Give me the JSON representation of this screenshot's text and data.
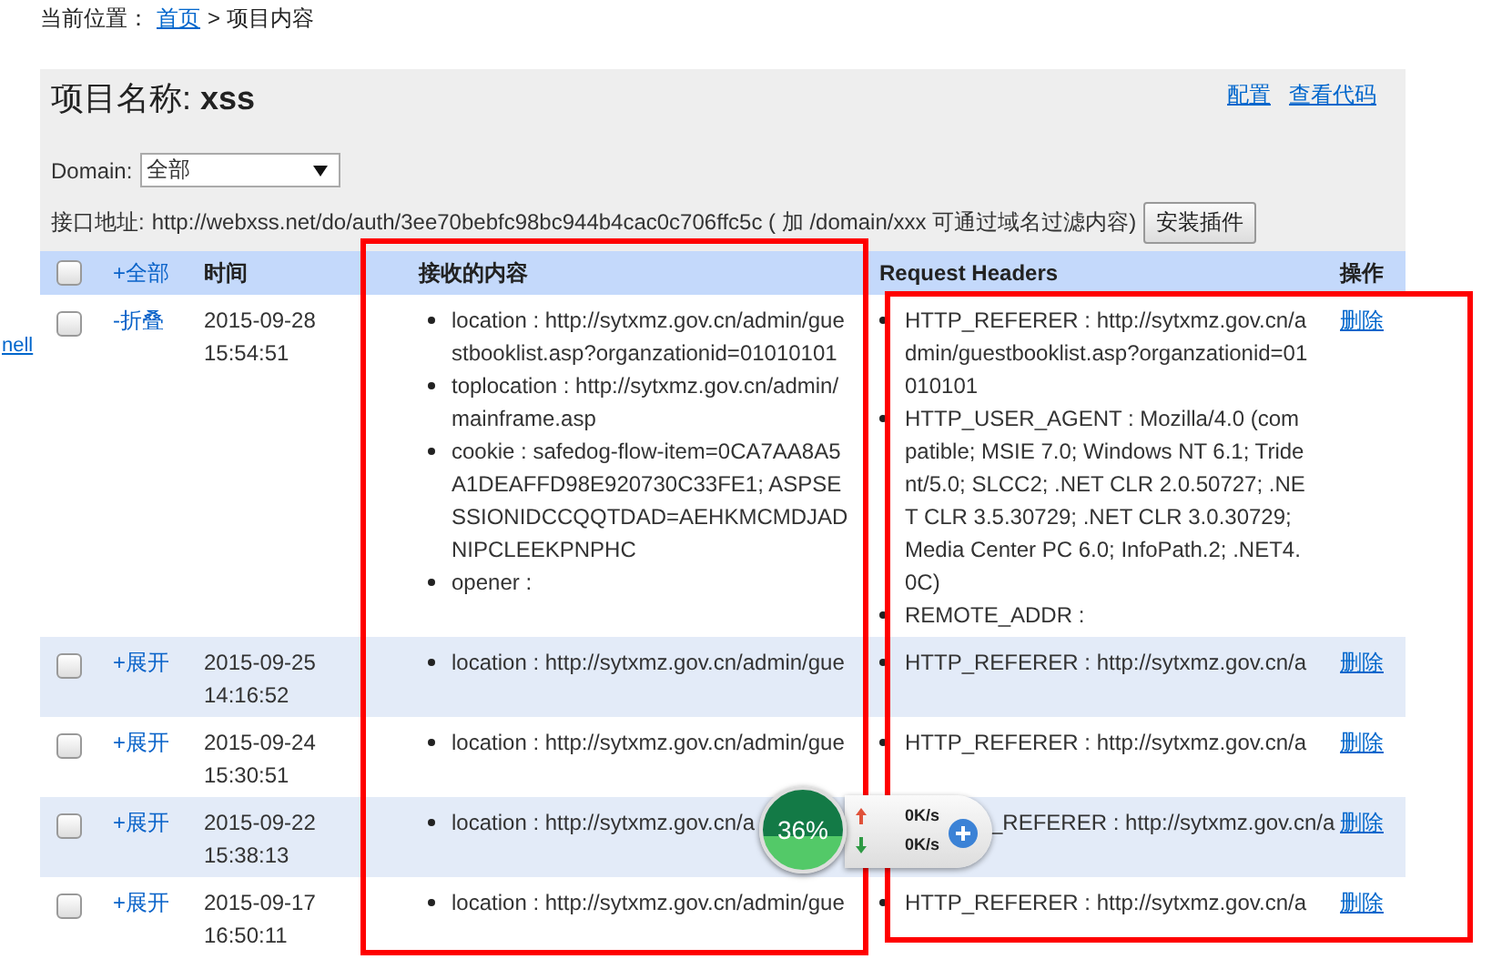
{
  "sidebar": {
    "link": "nell"
  },
  "breadcrumb": {
    "label": "当前位置：",
    "home_link": "首页",
    "current": "> 项目内容"
  },
  "project": {
    "title": "项目名称: **xss**",
    "links": [
      "配置",
      "查看代码"
    ],
    "domain_label": "Domain:",
    "domain_value": "全部",
    "address_label": "接口地址:",
    "address": "http://webxss.net/do/auth/3ee70bebfc98bc944b4cac0c706ffc5c ( 加 /domain/xxx 可通过域名过滤内容)",
    "install_button": "安装插件"
  },
  "table": {
    "header": {
      "select_all_checked": false,
      "toggle_all": "+全部",
      "time": "时间",
      "content": "接收的内容",
      "headers": "Request Headers",
      "action": "操作"
    },
    "rows": [
      {
        "checked": false,
        "partly_hidden": false,
        "toggle": "-折叠",
        "time": "2015-09-28 15:54:51",
        "content": [
          "location : http://sytxmz.gov.cn/admin/guestbooklist.asp?organzationid=01010101",
          "toplocation : http://sytxmz.gov.cn/admin/mainframe.asp",
          "cookie : safedog-flow-item=0CA7AA8A5A1DEAFFD98E920730C33FE1; ASPSESSIONIDCCQQTDAD=AEHKMCMDJADNIPCLEEKPNPHC",
          "opener :"
        ],
        "headers": [
          "HTTP_REFERER : http://sytxmz.gov.cn/admin/guestbooklist.asp?organzationid=01010101",
          "HTTP_USER_AGENT : Mozilla/4.0 (compatible; MSIE 7.0; Windows NT 6.1; Trident/5.0; SLCC2; .NET CLR 2.0.50727; .NET CLR 3.5.30729; .NET CLR 3.0.30729; Media Center PC 6.0; InfoPath.2; .NET4.0C)",
          "REMOTE_ADDR :"
        ],
        "action": "删除"
      },
      {
        "checked": false,
        "partly_hidden": false,
        "toggle": "+展开",
        "time": "2015-09-25 14:16:52",
        "content": [
          "location : http://sytxmz.gov.cn/admin/gue"
        ],
        "headers": [
          "HTTP_REFERER : http://sytxmz.gov.cn/a"
        ],
        "action": "删除"
      },
      {
        "checked": false,
        "partly_hidden": false,
        "toggle": "+展开",
        "time": "2015-09-24 15:30:51",
        "content": [
          "location : http://sytxmz.gov.cn/admin/gue"
        ],
        "headers": [
          "HTTP_REFERER : http://sytxmz.gov.cn/a"
        ],
        "action": "删除"
      },
      {
        "checked": false,
        "partly_hidden": true,
        "toggle": "+展开",
        "time": "2015-09-22 15:38:13",
        "content": [
          "location : http://sytxmz.gov.cn/a"
        ],
        "headers": [
          "_REFERER : http://sytxmz.gov.cn/a"
        ],
        "action": "删除"
      },
      {
        "checked": false,
        "partly_hidden": false,
        "toggle": "+展开",
        "time": "2015-09-17 16:50:11",
        "content": [
          "location : http://sytxmz.gov.cn/admin/gue"
        ],
        "headers": [
          "HTTP_REFERER : http://sytxmz.gov.cn/a"
        ],
        "action": "删除"
      }
    ]
  },
  "speed_widget": {
    "percent": "36%",
    "upload": "0K/s",
    "download": "0K/s"
  }
}
